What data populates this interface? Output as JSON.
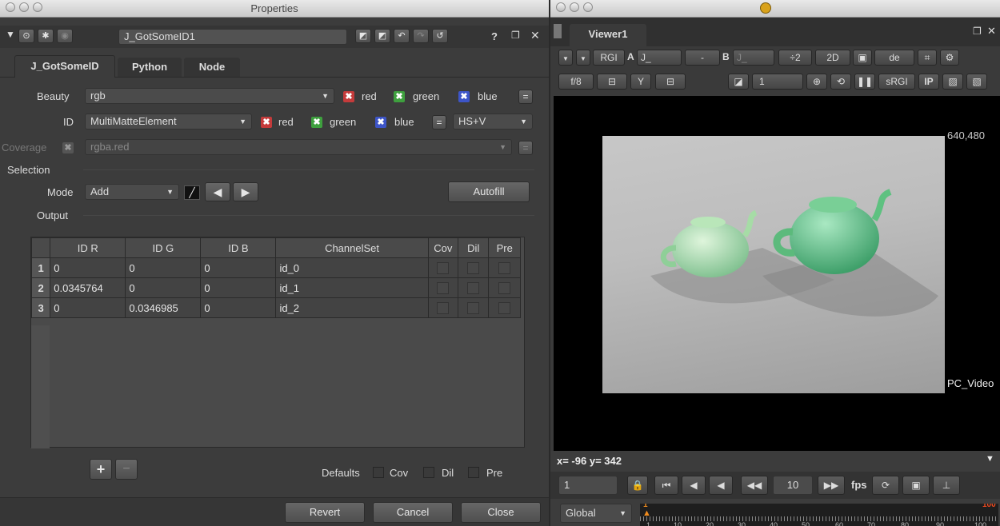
{
  "properties_window": {
    "title": "Properties",
    "node_name": "J_GotSomeID1",
    "tabs": [
      "J_GotSomeID",
      "Python",
      "Node"
    ],
    "beauty": {
      "label": "Beauty",
      "value": "rgb",
      "channels": [
        "red",
        "green",
        "blue"
      ]
    },
    "id": {
      "label": "ID",
      "value": "MultiMatteElement",
      "channels": [
        "red",
        "green",
        "blue"
      ],
      "mode_value": "HS+V"
    },
    "coverage": {
      "label": "Coverage",
      "value": "rgba.red"
    },
    "selection": {
      "label": "Selection",
      "mode_label": "Mode",
      "mode_value": "Add",
      "autofill": "Autofill"
    },
    "output": {
      "label": "Output"
    },
    "table": {
      "headers": [
        "ID R",
        "ID G",
        "ID B",
        "ChannelSet",
        "Cov",
        "Dil",
        "Pre"
      ],
      "rows": [
        {
          "num": "1",
          "r": "0",
          "g": "0",
          "b": "0",
          "set": "id_0"
        },
        {
          "num": "2",
          "r": "0.0345764",
          "g": "0",
          "b": "0",
          "set": "id_1"
        },
        {
          "num": "3",
          "r": "0",
          "g": "0.0346985",
          "b": "0",
          "set": "id_2"
        }
      ]
    },
    "add_row": "+",
    "remove_row": "−",
    "defaults": {
      "label": "Defaults",
      "cov": "Cov",
      "dil": "Dil",
      "pre": "Pre"
    },
    "buttons": {
      "revert": "Revert",
      "cancel": "Cancel",
      "close": "Close"
    },
    "help_icon": "?"
  },
  "viewer": {
    "tab": "Viewer1",
    "channels": "RGI",
    "input_a_label": "A",
    "input_a": "J_",
    "dash": "-",
    "input_b_label": "B",
    "input_b": "J_",
    "downrez": "÷2",
    "view_mode": "2D",
    "zoom_field": "de",
    "fstop": "f/8",
    "gamma_y": "Y",
    "frame_num": "1",
    "lut": "sRGI",
    "ip": "IP",
    "format_size": "640,480",
    "format_name": "PC_Video",
    "coords": "x= -96 y= 342",
    "frame_field": "1",
    "fps_value": "10",
    "fps_label": "fps",
    "scope": "Global",
    "timeline_ticks": [
      "1",
      "10",
      "20",
      "30",
      "40",
      "50",
      "60",
      "70",
      "80",
      "90",
      "100"
    ],
    "current_frame_marker": "1",
    "end_frame_marker": "100"
  },
  "colors": {
    "panel": "#3c3c3c",
    "viewer_bg": "#000000",
    "accent": "#f08c1e"
  }
}
